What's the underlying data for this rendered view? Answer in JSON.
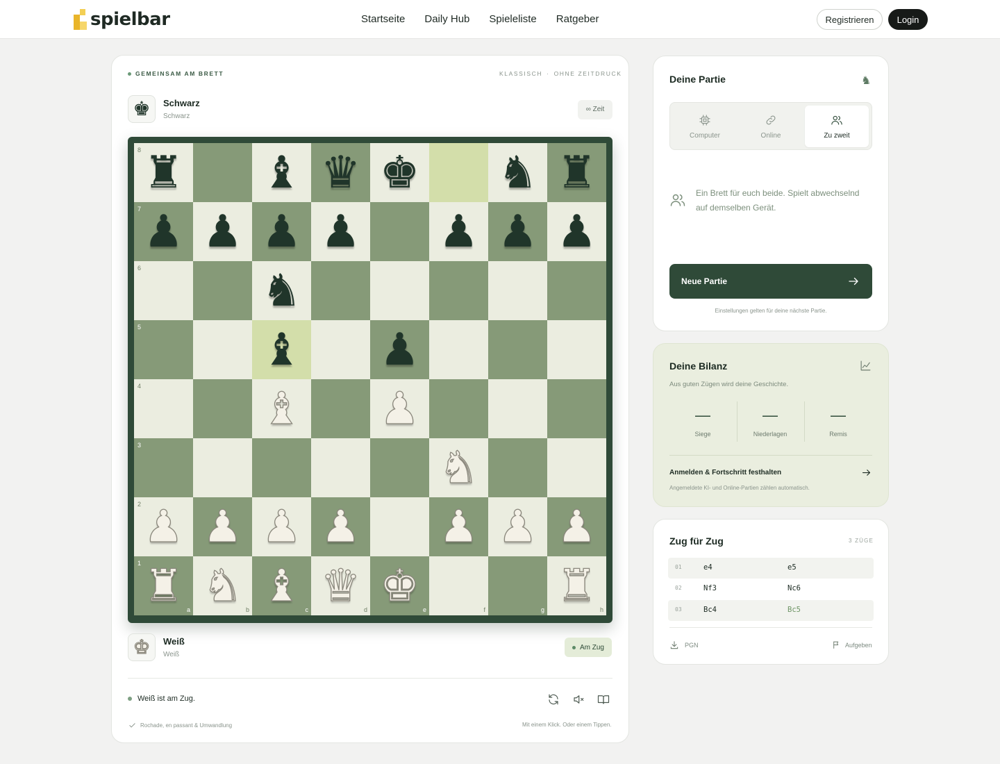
{
  "brand": {
    "name": "spielbar"
  },
  "nav": {
    "items": [
      "Startseite",
      "Daily Hub",
      "Spieleliste",
      "Ratgeber"
    ]
  },
  "auth": {
    "register": "Registrieren",
    "login": "Login"
  },
  "game": {
    "eyebrow_left": "GEMEINSAM AM BRETT",
    "eyebrow_right_1": "KLASSISCH",
    "eyebrow_sep": "·",
    "eyebrow_right_2": "OHNE ZEITDRUCK",
    "black": {
      "name": "Schwarz",
      "sub": "Schwarz"
    },
    "white": {
      "name": "Weiß",
      "sub": "Weiß"
    },
    "time_label": "∞ Zeit",
    "turn_label": "Am Zug",
    "status_text": "Weiß ist am Zug.",
    "foot_left": "Rochade, en passant & Umwandlung",
    "foot_right": "Mit einem Klick. Oder einem Tippen."
  },
  "board": {
    "files": [
      "a",
      "b",
      "c",
      "d",
      "e",
      "f",
      "g",
      "h"
    ],
    "ranks": [
      "8",
      "7",
      "6",
      "5",
      "4",
      "3",
      "2",
      "1"
    ],
    "position": [
      [
        "br",
        "",
        "bb",
        "bq",
        "bk",
        "",
        "bn",
        "br"
      ],
      [
        "bp",
        "bp",
        "bp",
        "bp",
        "",
        "bp",
        "bp",
        "bp"
      ],
      [
        "",
        "",
        "bn",
        "",
        "",
        "",
        "",
        ""
      ],
      [
        "",
        "",
        "bb",
        "",
        "bp",
        "",
        "",
        ""
      ],
      [
        "",
        "",
        "wb",
        "",
        "wp",
        "",
        "",
        ""
      ],
      [
        "",
        "",
        "",
        "",
        "",
        "wn",
        "",
        ""
      ],
      [
        "wp",
        "wp",
        "wp",
        "wp",
        "",
        "wp",
        "wp",
        "wp"
      ],
      [
        "wr",
        "wn",
        "wb",
        "wq",
        "wk",
        "",
        "",
        "wr"
      ]
    ],
    "highlights": [
      "f8",
      "c5"
    ],
    "colors": {
      "light": "#ebede0",
      "dark": "#869a78",
      "highlight": "#dde4bf",
      "frame": "#2f4a38"
    }
  },
  "partie": {
    "title": "Deine Partie",
    "modes": [
      {
        "label": "Computer",
        "icon": "cpu-icon"
      },
      {
        "label": "Online",
        "icon": "link-icon"
      },
      {
        "label": "Zu zweit",
        "icon": "users-icon"
      }
    ],
    "active_mode": "Zu zweit",
    "description": "Ein Brett für euch beide. Spielt abwechselnd auf demselben Gerät.",
    "new_game": "Neue Partie",
    "settings_note": "Einstellungen gelten für deine nächste Partie."
  },
  "bilanz": {
    "title": "Deine Bilanz",
    "subtitle": "Aus guten Zügen wird deine Geschichte.",
    "stats": [
      {
        "value": "—",
        "label": "Siege"
      },
      {
        "value": "—",
        "label": "Niederlagen"
      },
      {
        "value": "—",
        "label": "Remis"
      }
    ],
    "link": "Anmelden & Fortschritt festhalten",
    "note": "Angemeldete KI- und Online-Partien zählen automatisch."
  },
  "moves": {
    "title": "Zug für Zug",
    "count": "3 ZÜGE",
    "rows": [
      {
        "num": "01",
        "white": "e4",
        "black": "e5"
      },
      {
        "num": "02",
        "white": "Nf3",
        "black": "Nc6"
      },
      {
        "num": "03",
        "white": "Bc4",
        "black": "Bc5"
      }
    ],
    "pgn": "PGN",
    "resign": "Aufgeben"
  }
}
